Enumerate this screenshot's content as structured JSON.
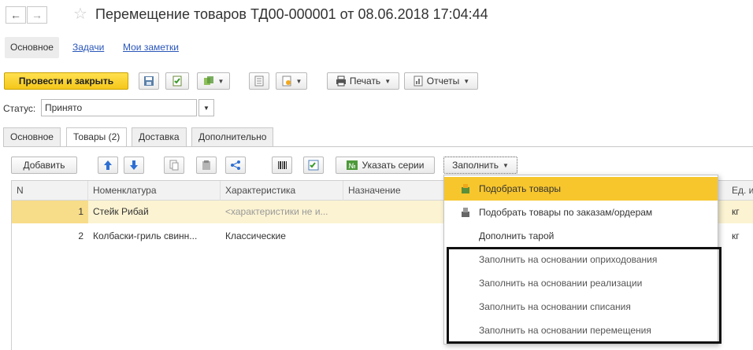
{
  "header": {
    "title": "Перемещение товаров ТД00-000001 от 08.06.2018 17:04:44"
  },
  "top_tabs": [
    {
      "label": "Основное"
    },
    {
      "label": "Задачи"
    },
    {
      "label": "Мои заметки"
    }
  ],
  "toolbar": {
    "post_close": "Провести и закрыть",
    "print": "Печать",
    "reports": "Отчеты"
  },
  "status": {
    "label": "Статус:",
    "value": "Принято"
  },
  "content_tabs": [
    {
      "label": "Основное"
    },
    {
      "label": "Товары (2)"
    },
    {
      "label": "Доставка"
    },
    {
      "label": "Дополнительно"
    }
  ],
  "table_toolbar": {
    "add": "Добавить",
    "series": "Указать серии",
    "fill": "Заполнить"
  },
  "table": {
    "columns": [
      "N",
      "Номенклатура",
      "Характеристика",
      "Назначение",
      "Ед. и"
    ],
    "rows": [
      {
        "n": "1",
        "name": "Стейк Рибай",
        "char": "<характеристики не и...",
        "unit": "кг"
      },
      {
        "n": "2",
        "name": "Колбаски-гриль свинн...",
        "char": "Классические",
        "unit": "кг"
      }
    ]
  },
  "fill_menu": {
    "items": [
      {
        "label": "Подобрать товары",
        "icon": "pick-goods-icon"
      },
      {
        "label": "Подобрать товары по заказам/ордерам",
        "icon": "pick-orders-icon"
      },
      {
        "label": "Дополнить тарой"
      },
      {
        "label": "Заполнить на основании оприходования"
      },
      {
        "label": "Заполнить на основании реализации"
      },
      {
        "label": "Заполнить на основании списания"
      },
      {
        "label": "Заполнить на основании перемещения"
      }
    ]
  },
  "colors": {
    "accent_yellow": "#f7c62d",
    "selected_row": "#fbf3d2",
    "link_blue": "#2a56b9"
  }
}
